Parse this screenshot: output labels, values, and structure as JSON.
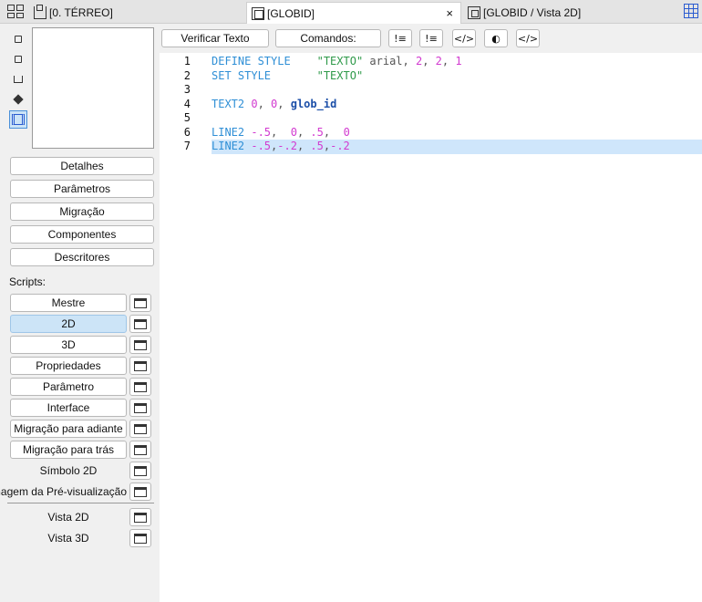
{
  "tabs": [
    {
      "label": "[0. TÉRREO]",
      "icon": "floor-plan-icon"
    },
    {
      "label": "[GLOBID]",
      "icon": "object-icon",
      "active": true,
      "close": "×"
    },
    {
      "label": "[GLOBID / Vista 2D]",
      "icon": "view-icon"
    }
  ],
  "left_panel": {
    "sections": [
      "Detalhes",
      "Parâmetros",
      "Migração",
      "Componentes",
      "Descritores"
    ],
    "scripts_label": "Scripts:",
    "scripts": [
      "Mestre",
      "2D",
      "3D",
      "Propriedades",
      "Parâmetro",
      "Interface",
      "Migração para adiante",
      "Migração para trás"
    ],
    "scripts_plain": [
      "Símbolo 2D",
      "Imagem da Pré-visualização"
    ],
    "views": [
      "Vista 2D",
      "Vista 3D"
    ]
  },
  "toolbar": {
    "check_label": "Verificar Texto",
    "commands_label": "Comandos:"
  },
  "editor": {
    "lines": [
      {
        "n": "1",
        "tokens": [
          [
            "kw",
            "DEFINE STYLE"
          ],
          [
            "txt",
            "    "
          ],
          [
            "str",
            "\"TEXTO\""
          ],
          [
            "txt",
            " arial, "
          ],
          [
            "num",
            "2"
          ],
          [
            "txt",
            ", "
          ],
          [
            "num",
            "2"
          ],
          [
            "txt",
            ", "
          ],
          [
            "num",
            "1"
          ]
        ]
      },
      {
        "n": "2",
        "tokens": [
          [
            "kw",
            "SET STYLE"
          ],
          [
            "txt",
            "       "
          ],
          [
            "str",
            "\"TEXTO\""
          ]
        ]
      },
      {
        "n": "3",
        "tokens": []
      },
      {
        "n": "4",
        "tokens": [
          [
            "kw",
            "TEXT2"
          ],
          [
            "txt",
            " "
          ],
          [
            "num",
            "0"
          ],
          [
            "txt",
            ", "
          ],
          [
            "num",
            "0"
          ],
          [
            "txt",
            ", "
          ],
          [
            "var",
            "glob_id"
          ]
        ]
      },
      {
        "n": "5",
        "tokens": []
      },
      {
        "n": "6",
        "tokens": [
          [
            "kw",
            "LINE2"
          ],
          [
            "txt",
            " "
          ],
          [
            "num",
            "-.5"
          ],
          [
            "txt",
            ",  "
          ],
          [
            "num",
            "0"
          ],
          [
            "txt",
            ", "
          ],
          [
            "num",
            ".5"
          ],
          [
            "txt",
            ",  "
          ],
          [
            "num",
            "0"
          ]
        ]
      },
      {
        "n": "7",
        "tokens": [
          [
            "kw",
            "LINE2"
          ],
          [
            "txt",
            " "
          ],
          [
            "num",
            "-.5"
          ],
          [
            "txt",
            ","
          ],
          [
            "num",
            "-.2"
          ],
          [
            "txt",
            ", "
          ],
          [
            "num",
            ".5"
          ],
          [
            "txt",
            ","
          ],
          [
            "num",
            "-.2"
          ]
        ]
      }
    ]
  }
}
